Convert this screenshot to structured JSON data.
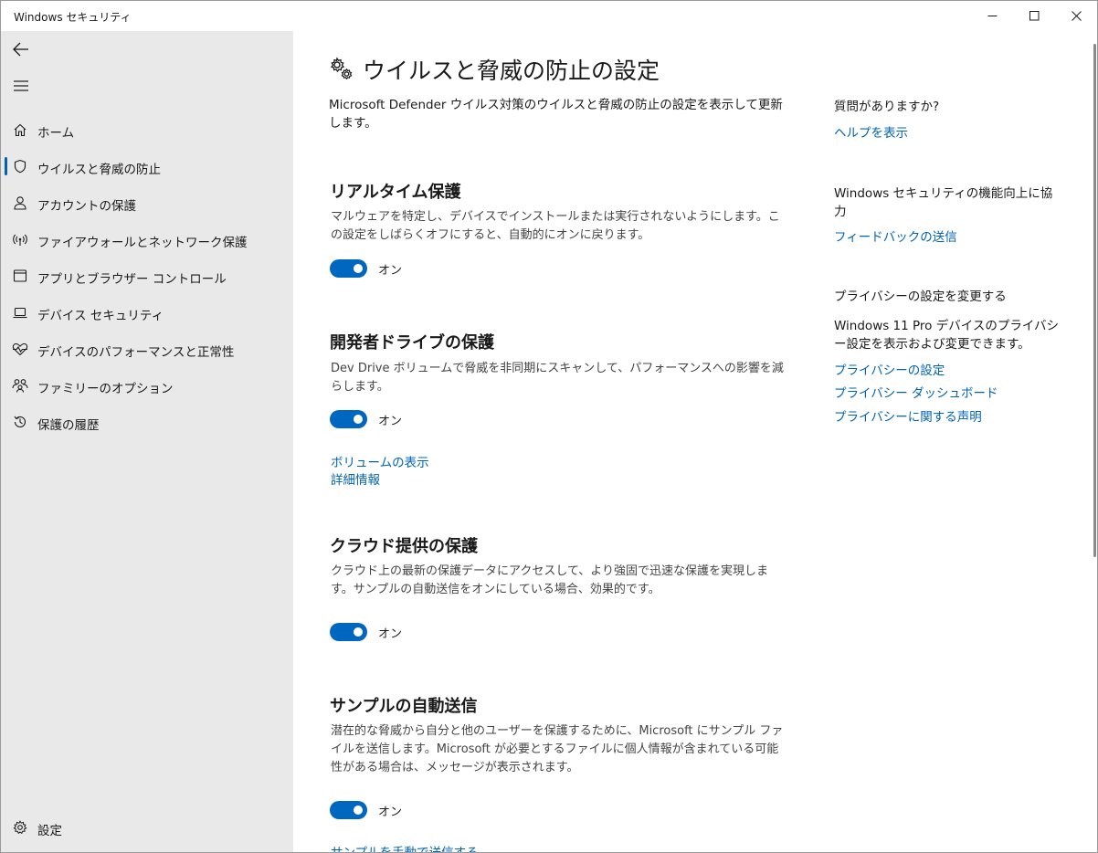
{
  "window": {
    "title": "Windows セキュリティ"
  },
  "sidebar": {
    "items": [
      {
        "label": "ホーム",
        "icon": "home-icon"
      },
      {
        "label": "ウイルスと脅威の防止",
        "icon": "shield-icon",
        "active": true
      },
      {
        "label": "アカウントの保護",
        "icon": "person-icon"
      },
      {
        "label": "ファイアウォールとネットワーク保護",
        "icon": "wireless-icon"
      },
      {
        "label": "アプリとブラウザー コントロール",
        "icon": "app-window-icon"
      },
      {
        "label": "デバイス セキュリティ",
        "icon": "laptop-icon"
      },
      {
        "label": "デバイスのパフォーマンスと正常性",
        "icon": "heart-pulse-icon"
      },
      {
        "label": "ファミリーのオプション",
        "icon": "family-icon"
      },
      {
        "label": "保護の履歴",
        "icon": "history-icon"
      }
    ],
    "settings_label": "設定"
  },
  "main": {
    "title": "ウイルスと脅威の防止の設定",
    "description": "Microsoft Defender ウイルス対策のウイルスと脅威の防止の設定を表示して更新します。",
    "sections": [
      {
        "title": "リアルタイム保護",
        "description": "マルウェアを特定し、デバイスでインストールまたは実行されないようにします。この設定をしばらくオフにすると、自動的にオンに戻ります。",
        "toggle_state": "オン"
      },
      {
        "title": "開発者ドライブの保護",
        "description": "Dev Drive ボリュームで脅威を非同期にスキャンして、パフォーマンスへの影響を減らします。",
        "toggle_state": "オン",
        "links": [
          "ボリュームの表示",
          "詳細情報"
        ]
      },
      {
        "title": "クラウド提供の保護",
        "description": "クラウド上の最新の保護データにアクセスして、より強固で迅速な保護を実現します。サンプルの自動送信をオンにしている場合、効果的です。",
        "toggle_state": "オン"
      },
      {
        "title": "サンプルの自動送信",
        "description": "潜在的な脅威から自分と他のユーザーを保護するために、Microsoft にサンプル ファイルを送信します。Microsoft が必要とするファイルに個人情報が含まれている可能性がある場合は、メッセージが表示されます。",
        "toggle_state": "オン",
        "links": [
          "サンプルを手動で送信する"
        ]
      }
    ]
  },
  "right_column": {
    "question_heading": "質問がありますか?",
    "help_link": "ヘルプを表示",
    "improve_heading": "Windows セキュリティの機能向上に協力",
    "feedback_link": "フィードバックの送信",
    "privacy_heading": "プライバシーの設定を変更する",
    "privacy_text": "Windows 11 Pro デバイスのプライバシー設定を表示および変更できます。",
    "privacy_links": [
      "プライバシーの設定",
      "プライバシー ダッシュボード",
      "プライバシーに関する声明"
    ]
  },
  "colors": {
    "accent": "#0067c0",
    "link": "#0063b1",
    "sidebar_bg": "#e9e9e9"
  }
}
